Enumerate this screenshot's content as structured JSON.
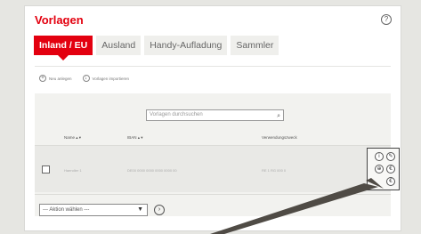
{
  "page": {
    "title": "Vorlagen",
    "help": "?"
  },
  "tabs": [
    {
      "label": "Inland / EU",
      "active": true
    },
    {
      "label": "Ausland",
      "active": false
    },
    {
      "label": "Handy-Aufladung",
      "active": false
    },
    {
      "label": "Sammler",
      "active": false
    }
  ],
  "actions": {
    "new_label": "Neu anlegen",
    "import_label": "Vorlagen importieren"
  },
  "search": {
    "placeholder": "Vorlagen durchsuchen"
  },
  "table": {
    "headers": {
      "name": "Name ▴ ▾",
      "iban": "IBAN ▴ ▾",
      "purpose": "Verwendungszweck"
    },
    "row": {
      "name": "Haendler 1",
      "iban": "DE00 0000 0000 0000 0000 00",
      "purpose": "RE 1 RG 000 0"
    }
  },
  "row_icons": [
    "info-icon",
    "edit-icon",
    "copy-icon",
    "transfer-icon",
    "delete-icon"
  ],
  "bulk": {
    "select_value": "--- Aktion wählen ---"
  },
  "colors": {
    "accent": "#e3000f"
  }
}
